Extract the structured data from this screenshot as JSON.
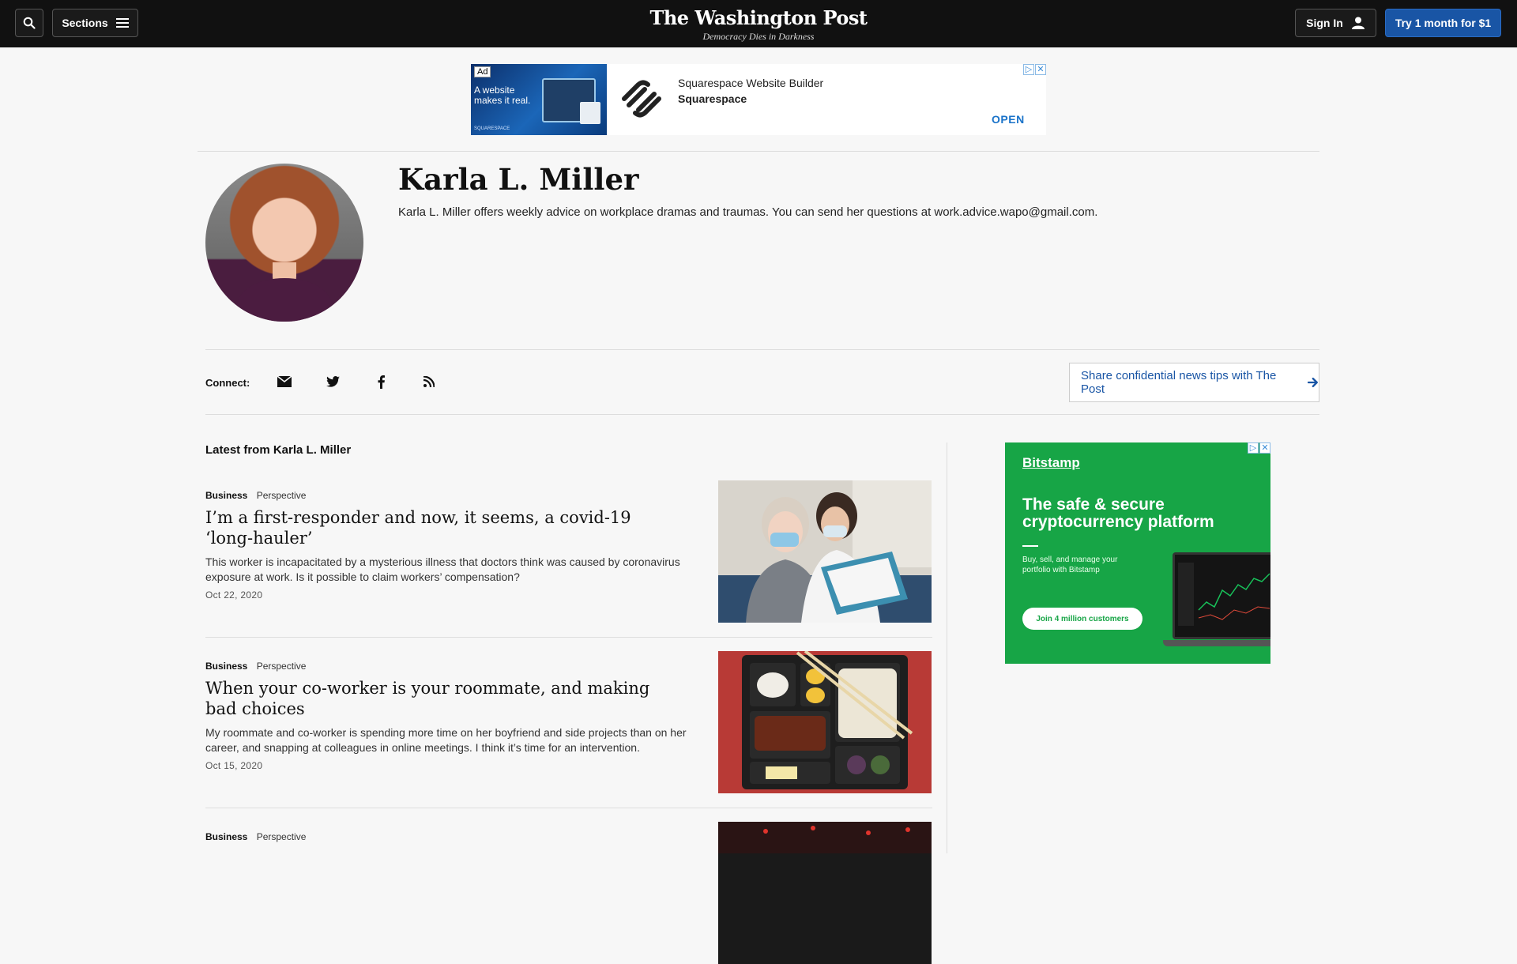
{
  "header": {
    "sections_label": "Sections",
    "logo_name": "The Washington Post",
    "logo_tagline": "Democracy Dies in Darkness",
    "signin_label": "Sign In",
    "trial_label": "Try 1 month for $1"
  },
  "top_ad": {
    "badge": "Ad",
    "image_text": "A website makes it real.",
    "footer_brand": "SQUARESPACE",
    "title": "Squarespace Website Builder",
    "brand": "Squarespace",
    "cta": "OPEN"
  },
  "author": {
    "name": "Karla L. Miller",
    "bio": "Karla L. Miller offers weekly advice on workplace dramas and traumas. You can send her questions at work.advice.wapo@gmail.com."
  },
  "connect": {
    "label": "Connect:",
    "icons": [
      "email-icon",
      "twitter-icon",
      "facebook-icon",
      "rss-icon"
    ],
    "tips_label": "Share confidential news tips with The Post"
  },
  "latest": {
    "title": "Latest from Karla L. Miller",
    "stories": [
      {
        "section": "Business",
        "label": "Perspective",
        "headline": "I’m a first-responder and now, it seems, a covid-19 ‘long-hauler’",
        "blurb": "This worker is incapacitated by a mysterious illness that doctors think was caused by coronavirus exposure at work. Is it possible to claim workers’ compensation?",
        "date": "Oct 22, 2020"
      },
      {
        "section": "Business",
        "label": "Perspective",
        "headline": "When your co-worker is your roommate, and making bad choices",
        "blurb": "My roommate and co-worker is spending more time on her boyfriend and side projects than on her career, and snapping at colleagues in online meetings. I think it’s time for an intervention.",
        "date": "Oct 15, 2020"
      },
      {
        "section": "Business",
        "label": "Perspective"
      }
    ]
  },
  "side_ad": {
    "brand": "Bitstamp",
    "headline": "The safe & secure cryptocurrency platform",
    "subtext": "Buy, sell, and manage your portfolio with Bitstamp",
    "cta": "Join 4 million customers"
  },
  "colors": {
    "header_bg": "#111111",
    "trial_button": "#1955a5",
    "link_blue": "#1955a5",
    "bitstamp_green": "#17a546"
  }
}
